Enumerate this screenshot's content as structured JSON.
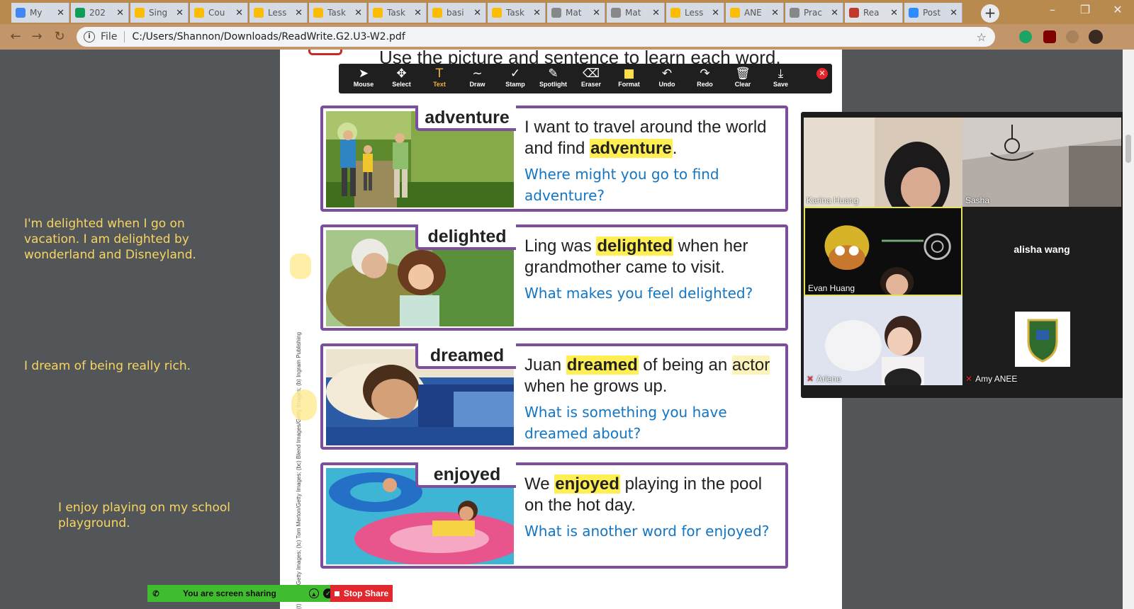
{
  "browser": {
    "tabs": [
      {
        "label": "My",
        "favicon_color": "#4285f4"
      },
      {
        "label": "202",
        "favicon_color": "#0f9d58"
      },
      {
        "label": "Sing",
        "favicon_color": "#fbbc04"
      },
      {
        "label": "Cou",
        "favicon_color": "#fbbc04"
      },
      {
        "label": "Less",
        "favicon_color": "#fbbc04"
      },
      {
        "label": "Task",
        "favicon_color": "#fbbc04"
      },
      {
        "label": "Task",
        "favicon_color": "#fbbc04"
      },
      {
        "label": "basi",
        "favicon_color": "#fbbc04"
      },
      {
        "label": "Task",
        "favicon_color": "#fbbc04"
      },
      {
        "label": "Mat",
        "favicon_color": "#888888"
      },
      {
        "label": "Mat",
        "favicon_color": "#888888"
      },
      {
        "label": "Less",
        "favicon_color": "#fbbc04"
      },
      {
        "label": "ANE",
        "favicon_color": "#fbbc04"
      },
      {
        "label": "Prac",
        "favicon_color": "#888888"
      },
      {
        "label": "Rea",
        "favicon_color": "#c0392b"
      },
      {
        "label": "Post",
        "favicon_color": "#2d8cff"
      }
    ],
    "address": {
      "scheme_label": "File",
      "url": "C:/Users/Shannon/Downloads/ReadWrite.G2.U3-W2.pdf"
    }
  },
  "pdf": {
    "heading": "Use the picture and sentence to learn each word.",
    "credit": "(t) L... ey/Getty Images; (tc) Tom Merton/Getty Images; (bc) Blend Images/Getty Images; (b) Ingram Publishing",
    "cards": [
      {
        "word": "adventure",
        "s1": "I want to travel around the world and find ",
        "s_hl": "adventure",
        "s2": ".",
        "question": "Where might you go to find adventure?"
      },
      {
        "word": "delighted",
        "s1": "Ling was ",
        "s_hl": "delighted",
        "s2": " when her grandmother came to visit.",
        "question": "What makes you feel delighted?"
      },
      {
        "word": "dreamed",
        "s1": "Juan ",
        "s_hl": "dreamed",
        "s2": " of being an ",
        "s_hl2": "actor",
        "s3": " when he grows up.",
        "question": "What is something you have dreamed about?"
      },
      {
        "word": "enjoyed",
        "s1": "We ",
        "s_hl": "enjoyed",
        "s2": " playing in the pool on the hot day.",
        "question": "What is another word for enjoyed?"
      }
    ]
  },
  "annotation_toolbar": {
    "tools": [
      {
        "label": "Mouse",
        "icon": "cursor-icon",
        "glyph": "➤"
      },
      {
        "label": "Select",
        "icon": "move-icon",
        "glyph": "✥"
      },
      {
        "label": "Text",
        "icon": "text-icon",
        "glyph": "T",
        "active": true
      },
      {
        "label": "Draw",
        "icon": "squiggle-icon",
        "glyph": "∼"
      },
      {
        "label": "Stamp",
        "icon": "check-icon",
        "glyph": "✓"
      },
      {
        "label": "Spotlight",
        "icon": "wand-icon",
        "glyph": "✎"
      },
      {
        "label": "Eraser",
        "icon": "eraser-icon",
        "glyph": "⌫"
      },
      {
        "label": "Format",
        "icon": "color-swatch-icon",
        "glyph": "■"
      },
      {
        "label": "Undo",
        "icon": "undo-icon",
        "glyph": "↶"
      },
      {
        "label": "Redo",
        "icon": "redo-icon",
        "glyph": "↷"
      },
      {
        "label": "Clear",
        "icon": "trash-icon",
        "glyph": "🗑"
      },
      {
        "label": "Save",
        "icon": "save-icon",
        "glyph": "⤓"
      }
    ],
    "accent_color": "#f5b33c"
  },
  "notes": {
    "n1": "I'm delighted when I go on vacation. I am delighted by wonderland and Disneyland.",
    "n2": "I dream of being really rich.",
    "n3": "I enjoy playing on my school playground."
  },
  "gallery": {
    "participants": [
      {
        "name": "Karina Huang"
      },
      {
        "name": "Sasha"
      },
      {
        "name": "Evan Huang",
        "speaking": true
      },
      {
        "name": "alisha wang",
        "video_off": true
      },
      {
        "name": "Arlene",
        "muted": true
      },
      {
        "name": "Amy ANEE",
        "muted": true
      }
    ]
  },
  "share_bar": {
    "status": "You are screen sharing",
    "stop_label": "Stop Share"
  }
}
